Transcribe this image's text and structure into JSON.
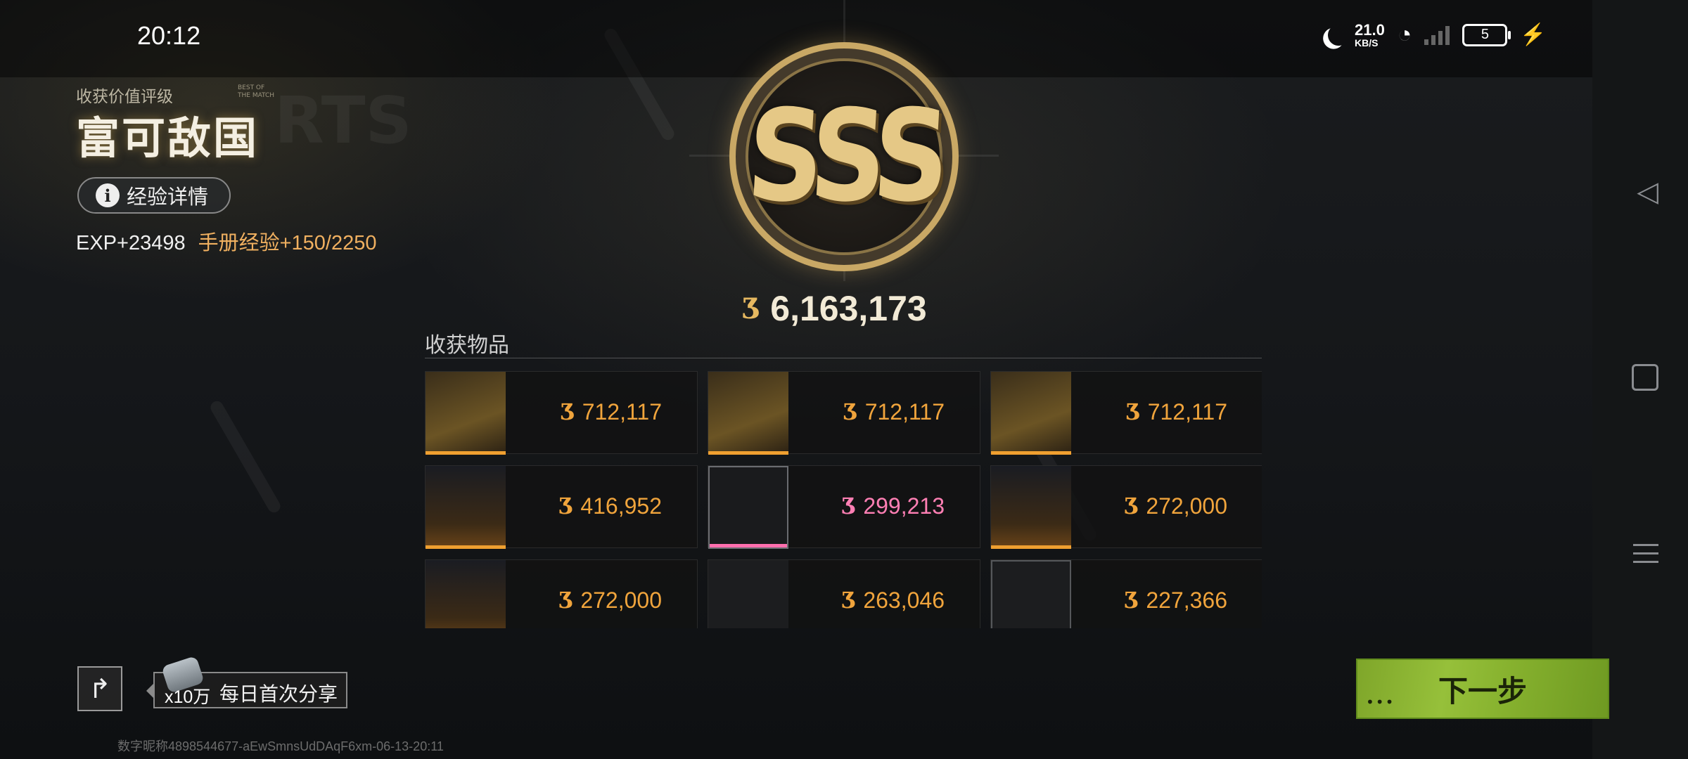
{
  "status": {
    "time": "20:12",
    "net_speed_value": "21.0",
    "net_speed_unit": "KB/S",
    "battery": "5",
    "icons": [
      "moon-icon",
      "wifi-icon",
      "signal-icon",
      "battery-icon",
      "charging-icon"
    ]
  },
  "nav": {
    "icons": [
      "back-icon",
      "home-icon",
      "recents-icon"
    ]
  },
  "rating": {
    "label": "收获价值评级",
    "best_of": [
      "BEST OF",
      "THE MATCH"
    ],
    "title": "富可敌国",
    "grade": "SSS"
  },
  "exp": {
    "details_button": "经验详情",
    "exp_gain": "EXP+23498",
    "handbook_exp": "手册经验+150/2250"
  },
  "total_value": "6,163,173",
  "currency_icon": "coin-icon",
  "loot": {
    "title": "收获物品",
    "items": [
      {
        "price": "712,117",
        "rarity_color": "#f0a030",
        "icon": "secret-document-icon"
      },
      {
        "price": "712,117",
        "rarity_color": "#f0a030",
        "icon": "secret-document-icon"
      },
      {
        "price": "712,117",
        "rarity_color": "#f0a030",
        "icon": "secret-document-icon"
      },
      {
        "price": "416,952",
        "rarity_color": "#f0a030",
        "icon": "crab-figurine-icon"
      },
      {
        "price": "299,213",
        "rarity_color": "#ff6fae",
        "icon": "rifle-icon"
      },
      {
        "price": "272,000",
        "rarity_color": "#f0a030",
        "icon": "device-icon"
      },
      {
        "price": "272,000",
        "rarity_color": "#f0a030",
        "icon": "device-icon"
      },
      {
        "price": "263,046",
        "rarity_color": "#f0a030",
        "icon": "bat-icon"
      },
      {
        "price": "227,366",
        "rarity_color": "#f0a030",
        "icon": "cable-icon"
      }
    ]
  },
  "share": {
    "reward_multiplier": "x10万",
    "label": "每日首次分享"
  },
  "footer_id": "数字昵称4898544677-aEwSmnsUdDAqF6xm-06-13-20:11",
  "next_button": "下一步",
  "colors": {
    "accent_green": "#8ab832",
    "gold": "#c9a865",
    "price_orange": "#f0a43c",
    "price_pink": "#ff7fb4"
  }
}
